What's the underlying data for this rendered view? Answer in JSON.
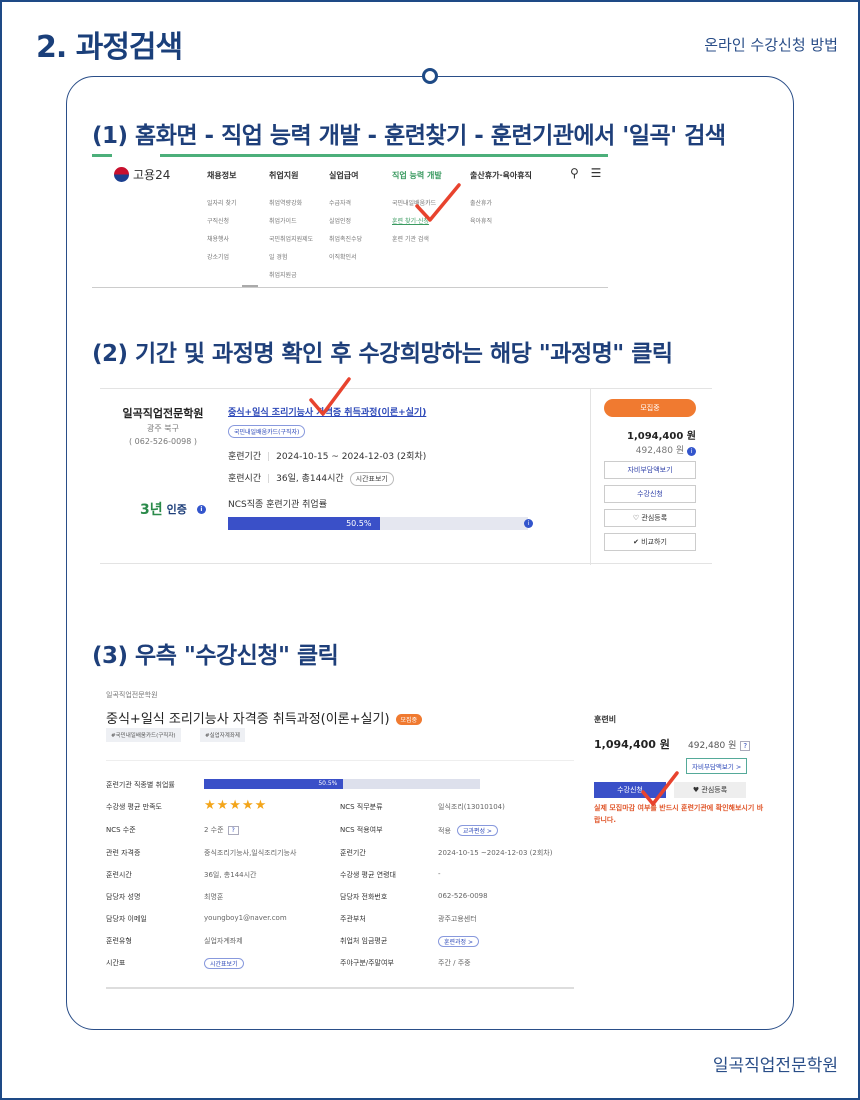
{
  "header": {
    "title": "2. 과정검색",
    "subtitle": "온라인 수강신청 방법"
  },
  "footer": {
    "academy": "일곡직업전문학원"
  },
  "steps": [
    "(1) 홈화면 - 직업 능력 개발 - 훈련찾기 - 훈련기관에서 '일곡' 검색",
    "(2) 기간 및 과정명 확인 후 수강희망하는 해당 \"과정명\" 클릭",
    "(3) 우측 \"수강신청\" 클릭"
  ],
  "colors": {
    "brand": "#1e3f7a",
    "check": "#e8432e",
    "green": "#3a9a60",
    "orange": "#f07a30",
    "blue": "#3a50c8"
  },
  "shot1": {
    "logo": "고용24",
    "nav": [
      "채용정보",
      "취업지원",
      "실업급여",
      "직업 능력 개발",
      "출산휴가·육아휴직"
    ],
    "sub": [
      [
        "일자리 찾기",
        "구직신청",
        "채용행사",
        "강소기업"
      ],
      [
        "취업역량강화",
        "취업가이드",
        "국민취업지원제도",
        "일 경험",
        "취업지원금"
      ],
      [
        "수급자격",
        "실업인정",
        "취업촉진수당",
        "이직확인서"
      ],
      [
        "국민내일배움카드",
        "훈련 찾기·신청",
        "훈련 기관 검색"
      ],
      [
        "출산휴가",
        "육아휴직"
      ]
    ],
    "icons": {
      "search": "search-icon",
      "menu": "hamburger-icon"
    }
  },
  "shot2": {
    "academy": "일곡직업전문학원",
    "location": "광주 북구",
    "tel": "( 062-526-0098 )",
    "cert_num": "3년",
    "cert_label": "인증",
    "course": "중식+일식 조리기능사 자격증 취득과정(이론+실기)",
    "tag": "국민내일배움카드(구직자)",
    "period_label": "훈련기간",
    "period": "2024-10-15 ~ 2024-12-03 (2회차)",
    "time_label": "훈련시간",
    "time": "36일, 총144시간",
    "timetable_btn": "시간표보기",
    "ncs": "NCS직종 훈련기관 취업률",
    "rate": "50.5%",
    "rate_value": 50.5,
    "recruit": "모집중",
    "price": "1,094,400 원",
    "price_self": "492,480 원",
    "buttons": [
      "자비부담액보기",
      "수강신청",
      "관심등록",
      "비교하기"
    ]
  },
  "shot3": {
    "academy": "일곡직업전문학원",
    "title": "중식+일식 조리기능사 자격증 취득과정(이론+실기)",
    "badge": "모집중",
    "tags": [
      "#국민내일배움카드(구직자)",
      "#실업자계좌제"
    ],
    "rate_label": "훈련기관 직종별 취업률",
    "rate": "50.5%",
    "rate_value": 50.5,
    "left_rows": [
      {
        "label": "수강생 평균 만족도",
        "value": ""
      },
      {
        "label": "NCS 수준",
        "value": "2 수준"
      },
      {
        "label": "관련 자격증",
        "value": "중식조리기능사,일식조리기능사"
      },
      {
        "label": "훈련시간",
        "value": "36일, 총144시간"
      },
      {
        "label": "담당자 성명",
        "value": "최명훈"
      },
      {
        "label": "담당자 이메일",
        "value": "youngboy1@naver.com"
      },
      {
        "label": "훈련유형",
        "value": "실업자계좌제"
      },
      {
        "label": "시간표",
        "value": ""
      }
    ],
    "right_rows": [
      {
        "label": "NCS 직무분류",
        "value": "일식조리(13010104)"
      },
      {
        "label": "NCS 적용여부",
        "value": "적용"
      },
      {
        "label": "훈련기간",
        "value": "2024-10-15 ~2024-12-03 (2회차)"
      },
      {
        "label": "수강생 평균 연령대",
        "value": "-"
      },
      {
        "label": "담당자 전화번호",
        "value": "062-526-0098"
      },
      {
        "label": "주관부처",
        "value": "광주고용센터"
      },
      {
        "label": "취업처 임금평균",
        "value": ""
      },
      {
        "label": "주야구분/주말여부",
        "value": "주간 / 주중"
      }
    ],
    "stars": "★★★★★",
    "help": "?",
    "pill_curriculum": "교과편성 >",
    "pill_course": "훈련과정 >",
    "pill_timetable": "시간표보기",
    "fee_label": "훈련비",
    "fee": "1,094,400 원",
    "fee_self": "492,480 원",
    "self_btn": "자비부담액보기 >",
    "apply_btn": "수강신청",
    "like_btn": "관심등록",
    "warning": "실제 모집마감 여부를 반드시 훈련기관에 확인해보시기 바랍니다."
  }
}
